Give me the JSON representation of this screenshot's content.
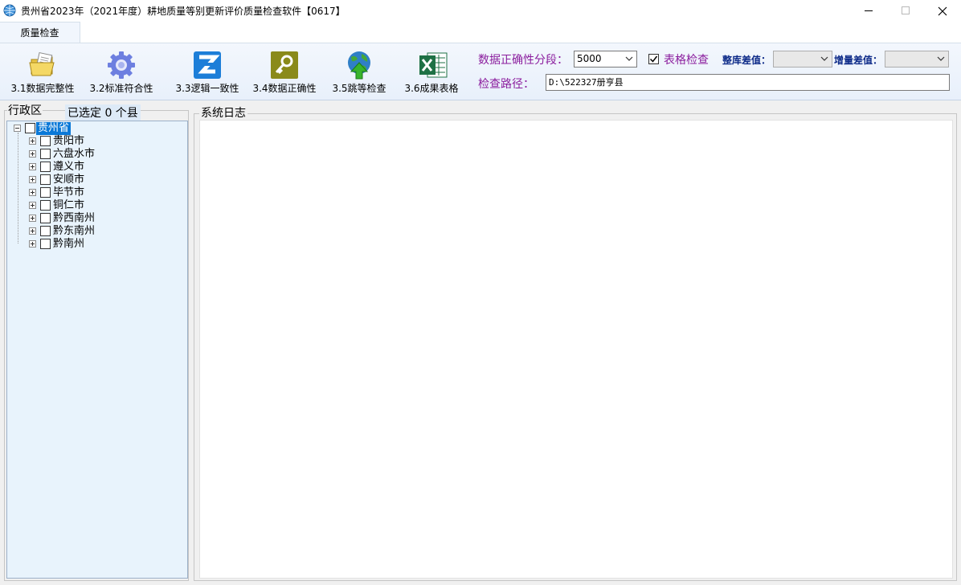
{
  "window": {
    "title": "贵州省2023年（2021年度）耕地质量等别更新评价质量检查软件【0617】",
    "icon": "app-globe-icon"
  },
  "ribbon": {
    "tabs": [
      {
        "label": "质量检查",
        "active": true
      }
    ],
    "buttons": [
      {
        "label": "3.1数据完整性",
        "icon": "folder-document-icon"
      },
      {
        "label": "3.2标准符合性",
        "icon": "gear-icon"
      },
      {
        "label": "3.3逻辑一致性",
        "icon": "z-logic-icon"
      },
      {
        "label": "3.4数据正确性",
        "icon": "key-icon"
      },
      {
        "label": "3.5跳等检查",
        "icon": "globe-upload-icon"
      },
      {
        "label": "3.6成果表格",
        "icon": "excel-icon"
      }
    ],
    "accuracy_label": "数据正确性分段：",
    "accuracy_value": "5000",
    "table_check_label": "表格检查",
    "table_check_checked": true,
    "whole_diff_label": "整库差值：",
    "whole_diff_value": "",
    "incr_diff_label": "增量差值：",
    "incr_diff_value": "",
    "path_label": "检查路径：",
    "path_value": "D:\\522327册亨县"
  },
  "region_panel": {
    "title": "行政区",
    "selected_text": "已选定 0 个县",
    "tree": {
      "root": "贵州省",
      "children": [
        "贵阳市",
        "六盘水市",
        "遵义市",
        "安顺市",
        "毕节市",
        "铜仁市",
        "黔西南州",
        "黔东南州",
        "黔南州"
      ]
    }
  },
  "log_panel": {
    "title": "系统日志"
  }
}
